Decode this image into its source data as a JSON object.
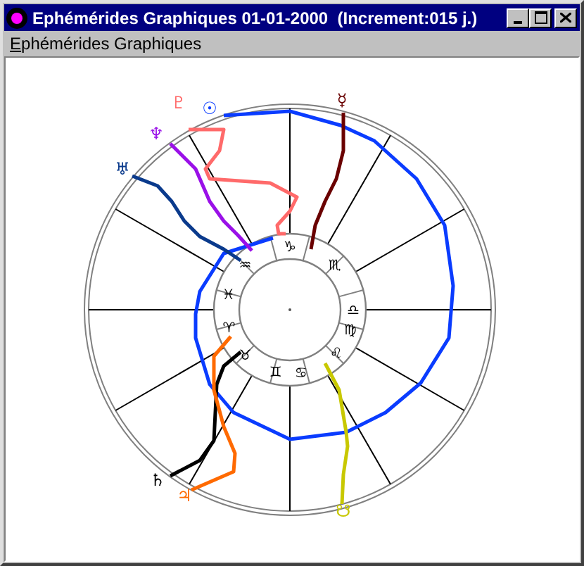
{
  "window": {
    "title": "Ephémérides Graphiques 01-01-2000  (Increment:015 j.)"
  },
  "menu": [
    {
      "label": "Ephémérides Graphiques",
      "first_letter_underlined": true
    }
  ],
  "chart": {
    "signs": [
      {
        "glyph": "♎"
      },
      {
        "glyph": "♏"
      },
      {
        "glyph": "♑"
      },
      {
        "glyph": "♒"
      },
      {
        "glyph": "♓"
      },
      {
        "glyph": "♈"
      },
      {
        "glyph": "♉"
      },
      {
        "glyph": "♊"
      },
      {
        "glyph": "♋"
      },
      {
        "glyph": "♌"
      },
      {
        "glyph": "♍"
      }
    ],
    "planets": [
      {
        "glyph": "♇",
        "color": "#ff6a6a"
      },
      {
        "glyph": "☉",
        "color": "#0a3cff"
      },
      {
        "glyph": "♆",
        "color": "#9a10e8"
      },
      {
        "glyph": "♅",
        "color": "#0a3a8c"
      },
      {
        "glyph": "☿",
        "color": "#6a0000"
      },
      {
        "glyph": "♄",
        "color": "#000000"
      },
      {
        "glyph": "♃",
        "color": "#ff6a00"
      },
      {
        "glyph": "☋",
        "color": "#c8c800"
      }
    ]
  }
}
